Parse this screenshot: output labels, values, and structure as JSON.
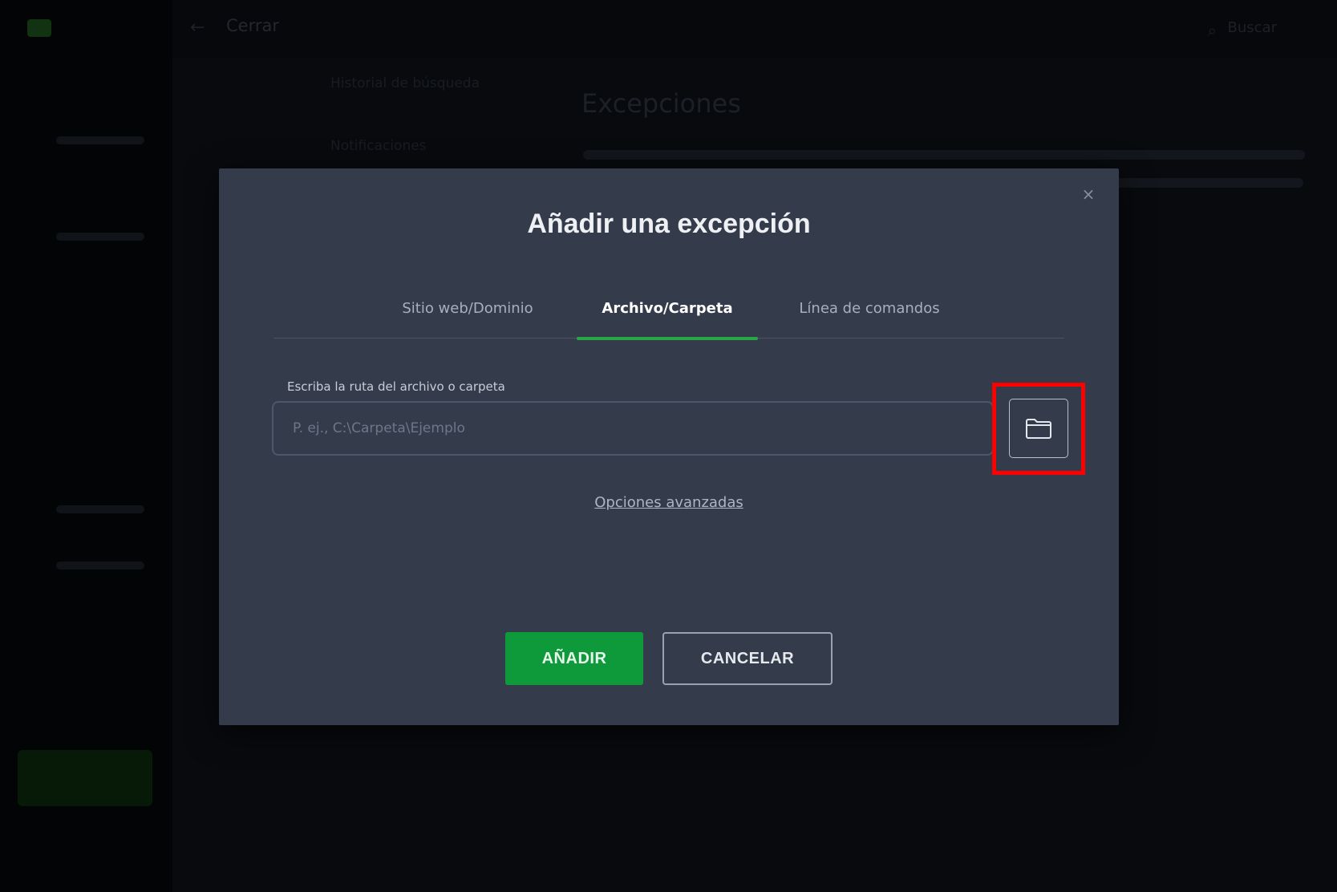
{
  "background": {
    "topbar": {
      "back_icon": "arrow-left-icon",
      "title": "Cerrar",
      "search_icon": "search-icon",
      "search_label": "Buscar"
    },
    "settings": {
      "sub_items": [
        "Historial de búsqueda",
        "Notificaciones"
      ],
      "heading": "Excepciones"
    }
  },
  "dialog": {
    "title": "Añadir una excepción",
    "close_icon": "close-icon",
    "tabs": [
      {
        "label": "Sitio web/Dominio",
        "active": false
      },
      {
        "label": "Archivo/Carpeta",
        "active": true
      },
      {
        "label": "Línea de comandos",
        "active": false
      }
    ],
    "field": {
      "label": "Escriba la ruta del archivo o carpeta",
      "value": "",
      "placeholder": "P. ej., C:\\Carpeta\\Ejemplo"
    },
    "browse_icon": "folder-icon",
    "advanced_link": "Opciones avanzadas",
    "buttons": {
      "add": "AÑADIR",
      "cancel": "CANCELAR"
    },
    "colors": {
      "dialog_bg": "#343b4b",
      "accent": "#28a745",
      "add_button": "#0e9a3a",
      "highlight": "#ff0000"
    }
  }
}
